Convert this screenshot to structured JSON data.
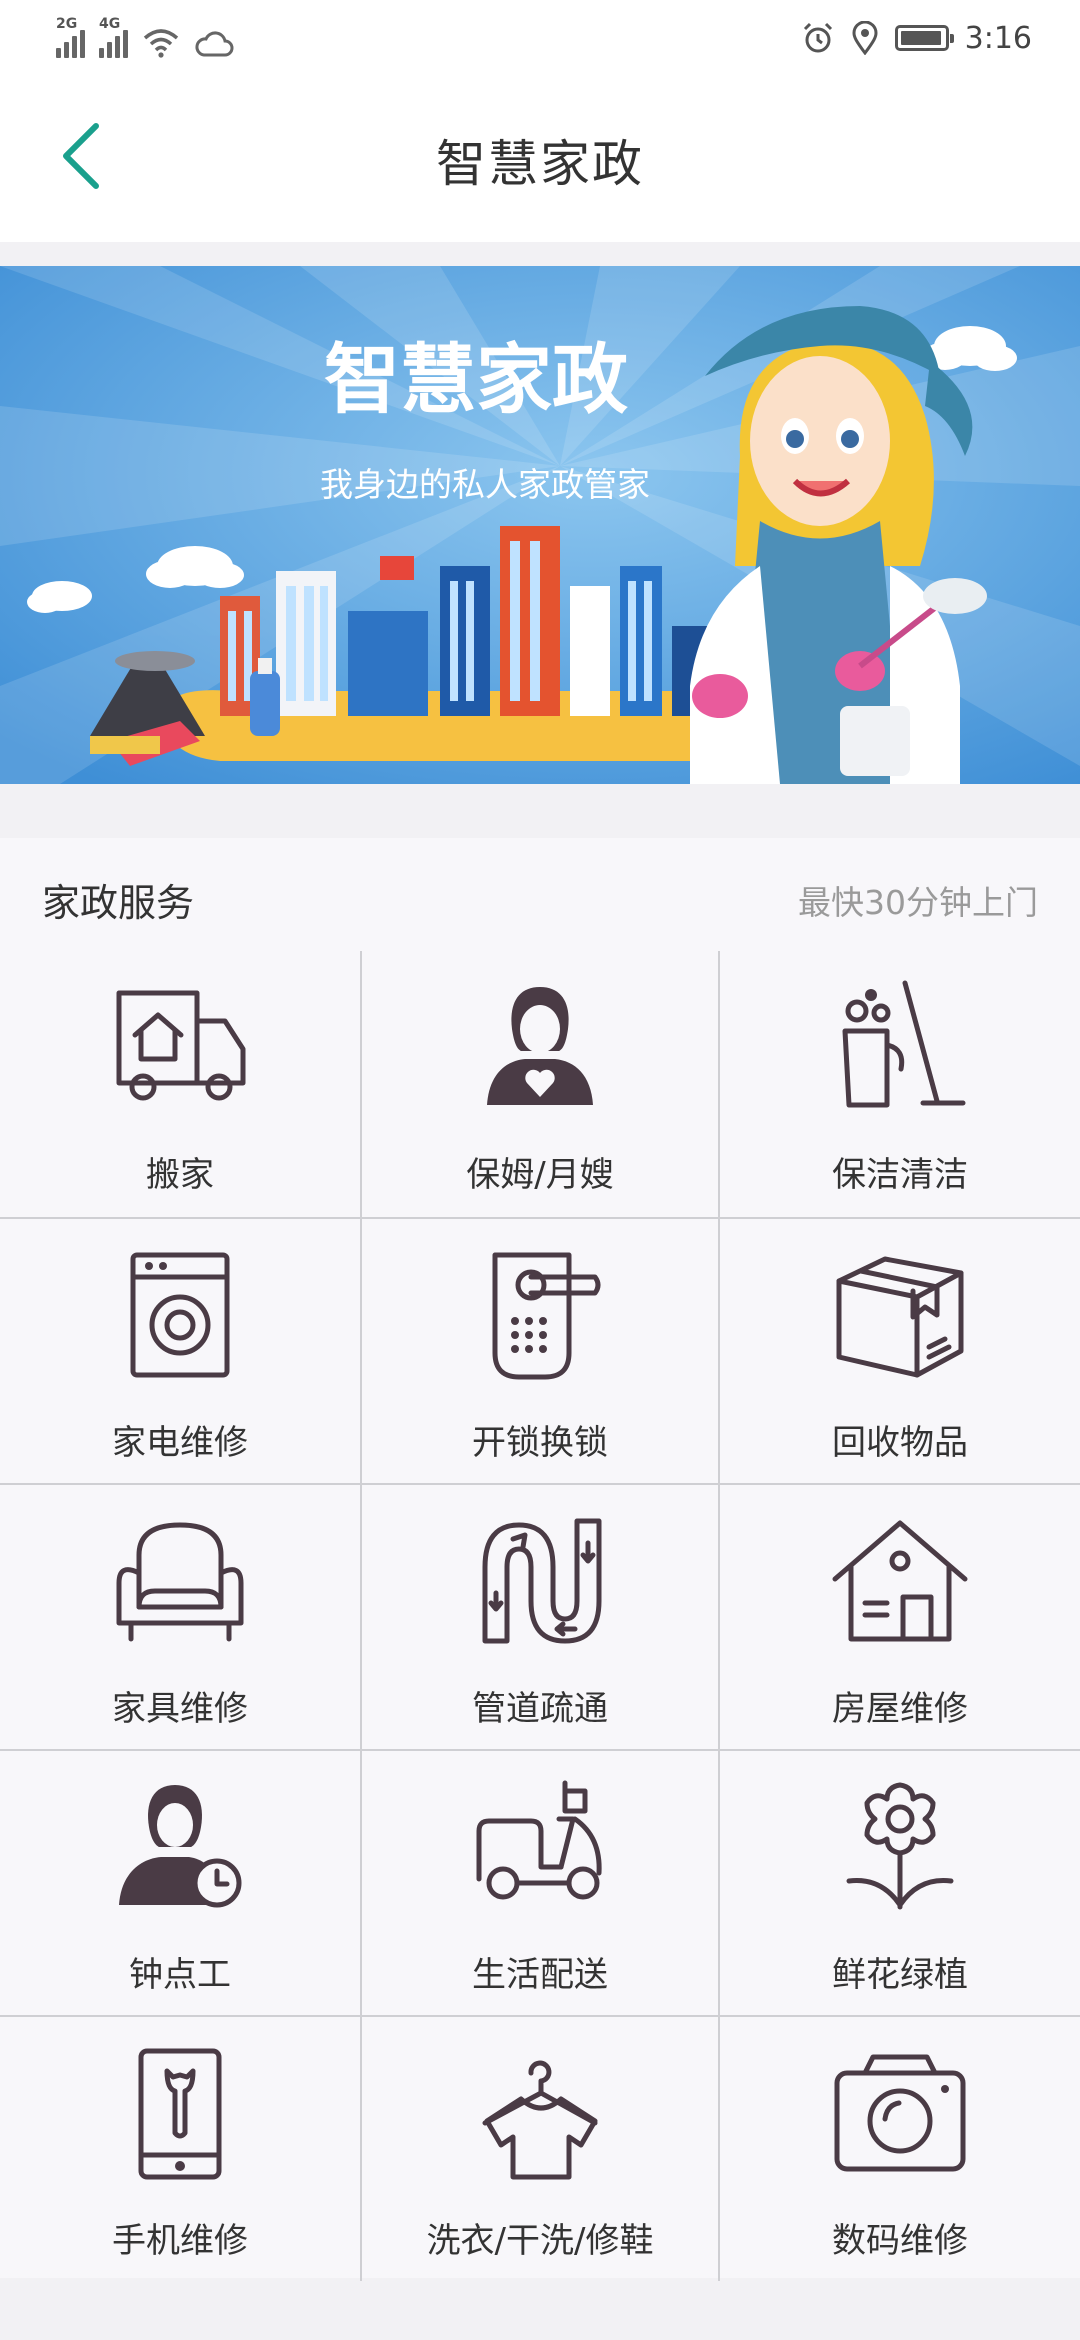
{
  "status_bar": {
    "network_1": "2G",
    "network_2": "4G",
    "time": "3:16",
    "icons": [
      "signal-icon",
      "signal-icon",
      "wifi-icon",
      "cloud-icon",
      "alarm-icon",
      "location-icon",
      "battery-icon"
    ],
    "battery_level": 0.9
  },
  "header": {
    "title": "智慧家政",
    "back_icon": "chevron-left-icon",
    "accent_color": "#1aa08d"
  },
  "banner": {
    "title": "智慧家政",
    "subtitle": "我身边的私人家政管家"
  },
  "services": {
    "title": "家政服务",
    "subtitle": "最快30分钟上门",
    "items": [
      {
        "label": "搬家",
        "icon": "truck-icon"
      },
      {
        "label": "保姆/月嫂",
        "icon": "nanny-icon"
      },
      {
        "label": "保洁清洁",
        "icon": "cleaning-icon"
      },
      {
        "label": "家电维修",
        "icon": "washing-machine-icon"
      },
      {
        "label": "开锁换锁",
        "icon": "door-lock-icon"
      },
      {
        "label": "回收物品",
        "icon": "box-icon"
      },
      {
        "label": "家具维修",
        "icon": "armchair-icon"
      },
      {
        "label": "管道疏通",
        "icon": "pipe-icon"
      },
      {
        "label": "房屋维修",
        "icon": "house-icon"
      },
      {
        "label": "钟点工",
        "icon": "hourly-worker-icon"
      },
      {
        "label": "生活配送",
        "icon": "scooter-icon"
      },
      {
        "label": "鲜花绿植",
        "icon": "flower-icon"
      },
      {
        "label": "手机维修",
        "icon": "phone-repair-icon"
      },
      {
        "label": "洗衣/干洗/修鞋",
        "icon": "laundry-icon"
      },
      {
        "label": "数码维修",
        "icon": "camera-icon"
      }
    ]
  }
}
